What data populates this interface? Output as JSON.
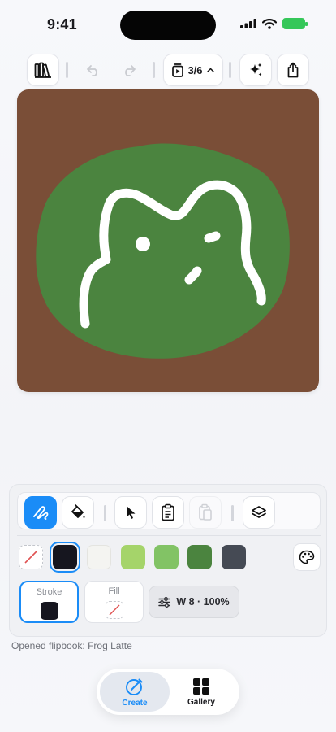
{
  "status_bar": {
    "time": "9:41"
  },
  "toolbar": {
    "library_icon": "books-icon",
    "undo_icon": "undo-icon",
    "redo_icon": "redo-icon",
    "frame_counter": "3/6",
    "frame_icon": "frame-play-icon",
    "magic_icon": "sparkles-icon",
    "share_icon": "share-icon"
  },
  "canvas": {
    "background_color": "#7a4e37",
    "blob_color": "#4b843f",
    "stroke_color": "#ffffff"
  },
  "tools": {
    "draw_icon": "pen-squiggle-icon",
    "fill_icon": "paint-bucket-icon",
    "select_icon": "cursor-arrow-icon",
    "clipboard_icon": "clipboard-icon",
    "paste_icon": "paste-icon",
    "layers_icon": "layers-icon",
    "accent_color": "#1a8cf7"
  },
  "swatches": [
    {
      "name": "none",
      "color": "none"
    },
    {
      "name": "black",
      "color": "#16161f",
      "selected": true
    },
    {
      "name": "white",
      "color": "#f4f4f1"
    },
    {
      "name": "light-green",
      "color": "#a5d46a"
    },
    {
      "name": "green",
      "color": "#82c365"
    },
    {
      "name": "dark-green",
      "color": "#4b843f"
    },
    {
      "name": "slate",
      "color": "#454a54"
    }
  ],
  "stroke_fill": {
    "stroke_label": "Stroke",
    "stroke_color": "#16161f",
    "fill_label": "Fill",
    "fill_color": "none"
  },
  "brush": {
    "label": "W 8 · 100%",
    "icon": "sliders-icon"
  },
  "status_message": "Opened flipbook: Frog Latte",
  "nav": {
    "create_label": "Create",
    "gallery_label": "Gallery",
    "active": "Create"
  }
}
